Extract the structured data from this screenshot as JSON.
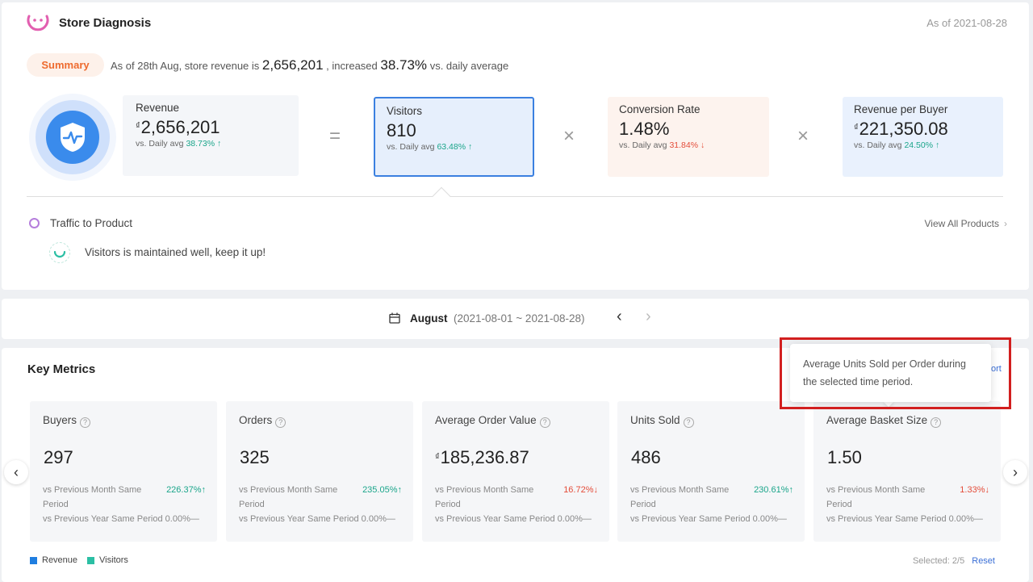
{
  "diagnosis": {
    "title": "Store Diagnosis",
    "as_of": "As of 2021-08-28",
    "summary_label": "Summary",
    "summary_prefix": "As of 28th Aug, store revenue is",
    "summary_revenue": "2,656,201",
    "summary_mid": ", increased",
    "summary_pct": "38.73%",
    "summary_suffix": "vs. daily average"
  },
  "formula": {
    "revenue": {
      "label": "Revenue",
      "currency": "₫",
      "value": "2,656,201",
      "sub_prefix": "vs. Daily avg",
      "change": "38.73%",
      "arrow": "↑",
      "trend": "up"
    },
    "eq": "=",
    "visitors": {
      "label": "Visitors",
      "value": "810",
      "sub_prefix": "vs. Daily avg",
      "change": "63.48%",
      "arrow": "↑",
      "trend": "up"
    },
    "times1": "×",
    "conversion": {
      "label": "Conversion Rate",
      "value": "1.48%",
      "sub_prefix": "vs. Daily avg",
      "change": "31.84%",
      "arrow": "↓",
      "trend": "down"
    },
    "times2": "×",
    "rpb": {
      "label": "Revenue per Buyer",
      "currency": "₫",
      "value": "221,350.08",
      "sub_prefix": "vs. Daily avg",
      "change": "24.50%",
      "arrow": "↑",
      "trend": "up"
    }
  },
  "traffic": {
    "title": "Traffic to Product",
    "view_all": "View All Products",
    "message": "Visitors is maintained well, keep it up!"
  },
  "date_bar": {
    "month": "August",
    "range": "(2021-08-01 ~ 2021-08-28)"
  },
  "key_metrics": {
    "title": "Key Metrics",
    "export_fragment": "ort",
    "cards": [
      {
        "label": "Buyers",
        "currency": "",
        "value": "297",
        "prev_month_label": "vs Previous Month Same Period",
        "prev_month_pct": "226.37%",
        "prev_month_arrow": "↑",
        "trend": "up",
        "prev_year_label": "vs Previous Year Same Period",
        "prev_year_pct": "0.00%",
        "prev_year_dash": "—"
      },
      {
        "label": "Orders",
        "currency": "",
        "value": "325",
        "prev_month_label": "vs Previous Month Same Period",
        "prev_month_pct": "235.05%",
        "prev_month_arrow": "↑",
        "trend": "up",
        "prev_year_label": "vs Previous Year Same Period",
        "prev_year_pct": "0.00%",
        "prev_year_dash": "—"
      },
      {
        "label": "Average Order Value",
        "currency": "₫",
        "value": "185,236.87",
        "prev_month_label": "vs Previous Month Same Period",
        "prev_month_pct": "16.72%",
        "prev_month_arrow": "↓",
        "trend": "down",
        "prev_year_label": "vs Previous Year Same Period",
        "prev_year_pct": "0.00%",
        "prev_year_dash": "—"
      },
      {
        "label": "Units Sold",
        "currency": "",
        "value": "486",
        "prev_month_label": "vs Previous Month Same Period",
        "prev_month_pct": "230.61%",
        "prev_month_arrow": "↑",
        "trend": "up",
        "prev_year_label": "vs Previous Year Same Period",
        "prev_year_pct": "0.00%",
        "prev_year_dash": "—"
      },
      {
        "label": "Average Basket Size",
        "currency": "",
        "value": "1.50",
        "prev_month_label": "vs Previous Month Same Period",
        "prev_month_pct": "1.33%",
        "prev_month_arrow": "↓",
        "trend": "down",
        "prev_year_label": "vs Previous Year Same Period",
        "prev_year_pct": "0.00%",
        "prev_year_dash": "—"
      }
    ],
    "legend": [
      {
        "label": "Revenue",
        "color": "#1f7ee0"
      },
      {
        "label": "Visitors",
        "color": "#2bbfa4"
      }
    ],
    "selected_label": "Selected:",
    "selected_count": "2/5",
    "reset_label": "Reset"
  },
  "tooltip": {
    "text": "Average Units Sold per Order during the selected time period."
  },
  "colors": {
    "up": "#1aa58a",
    "down": "#e44d3a",
    "accent": "#3b80e0",
    "highlight": "#d21f1f"
  }
}
